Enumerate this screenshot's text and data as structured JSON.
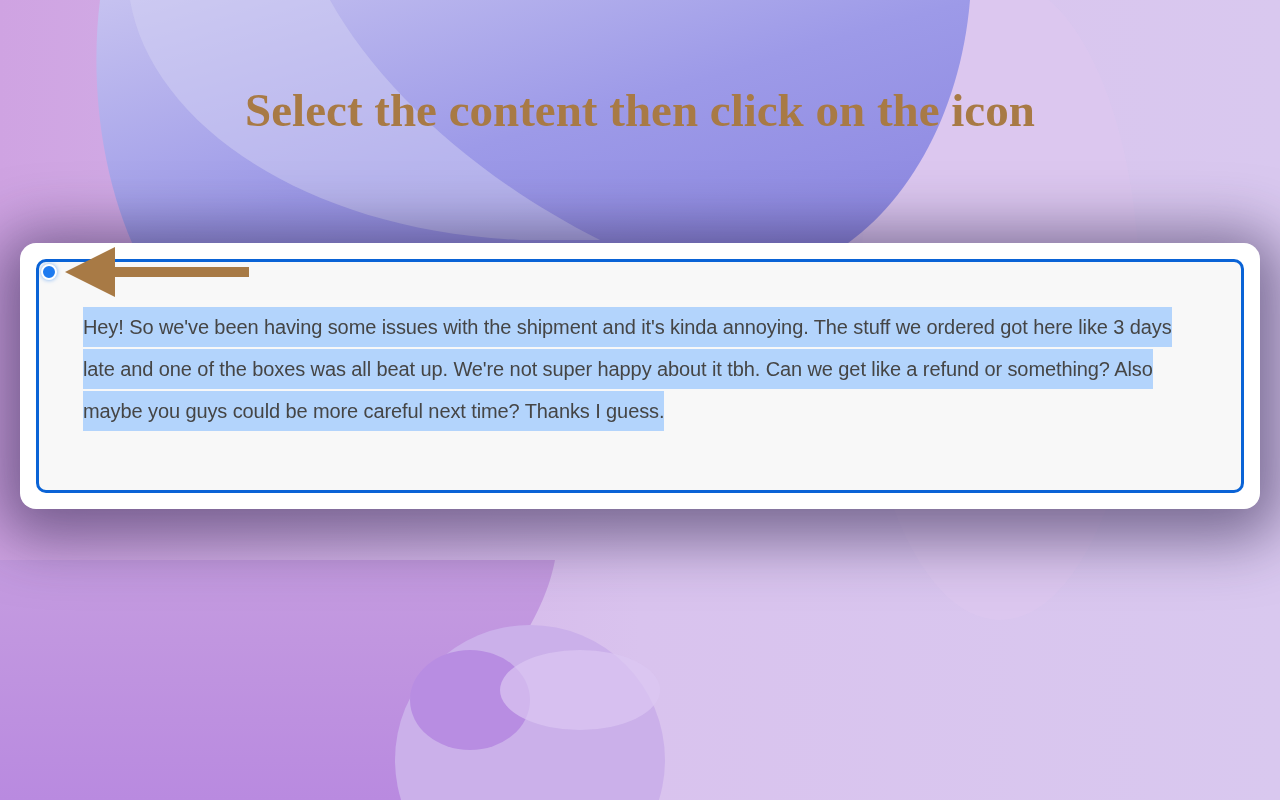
{
  "heading": "Select the content then click on the icon",
  "editor": {
    "text": "Hey! So we've been having some issues with the shipment and it's kinda annoying. The stuff we ordered got here like 3 days late and one of the boxes was all beat up. We're not super happy about it tbh. Can we get like a refund or something? Also maybe you guys could be more careful next time? Thanks I guess.",
    "selected": true
  }
}
